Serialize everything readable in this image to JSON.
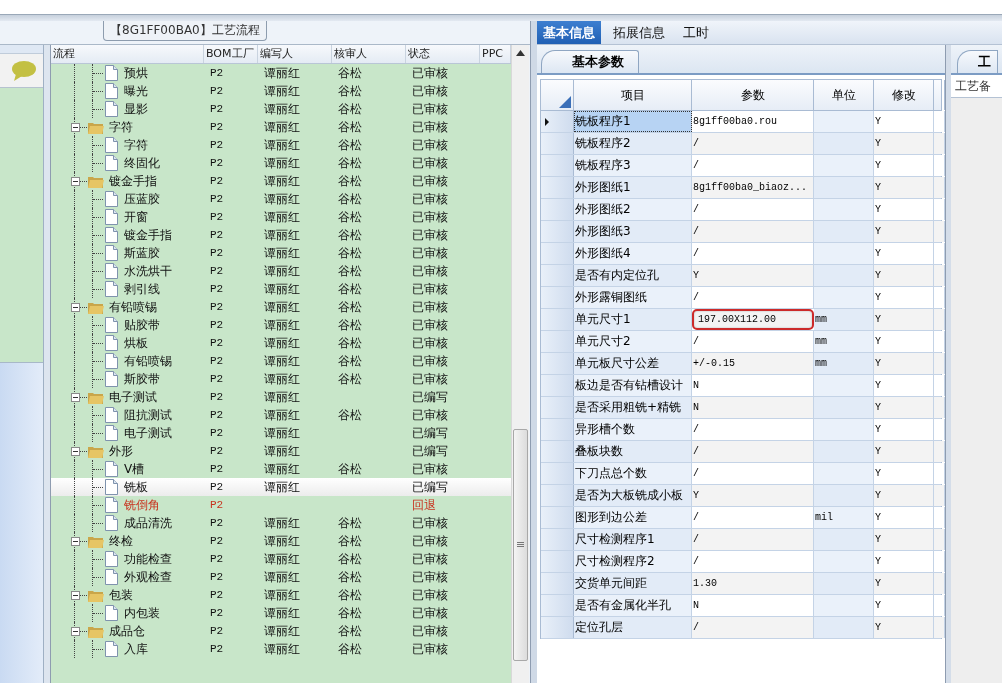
{
  "left_panel": {
    "title": "【8G1FF00BA0】工艺流程",
    "columns": [
      "流程",
      "BOM工厂",
      "编写人",
      "核审人",
      "状态",
      "PPC"
    ],
    "continued_children": [
      {
        "name": "预烘",
        "factory": "P2",
        "writer": "谭丽红",
        "reviewer": "谷松",
        "status": "已审核",
        "selected": false,
        "returned": false
      },
      {
        "name": "曝光",
        "factory": "P2",
        "writer": "谭丽红",
        "reviewer": "谷松",
        "status": "已审核",
        "selected": false,
        "returned": false
      },
      {
        "name": "显影",
        "factory": "P2",
        "writer": "谭丽红",
        "reviewer": "谷松",
        "status": "已审核",
        "selected": false,
        "returned": false
      }
    ],
    "groups": [
      {
        "name": "字符",
        "factory": "P2",
        "writer": "谭丽红",
        "reviewer": "谷松",
        "status": "已审核",
        "selected": false,
        "returned": false,
        "expanded": true,
        "children": [
          {
            "name": "字符",
            "factory": "P2",
            "writer": "谭丽红",
            "reviewer": "谷松",
            "status": "已审核",
            "selected": false,
            "returned": false
          },
          {
            "name": "终固化",
            "factory": "P2",
            "writer": "谭丽红",
            "reviewer": "谷松",
            "status": "已审核",
            "selected": false,
            "returned": false
          }
        ]
      },
      {
        "name": "镀金手指",
        "factory": "P2",
        "writer": "谭丽红",
        "reviewer": "谷松",
        "status": "已审核",
        "selected": false,
        "returned": false,
        "expanded": true,
        "children": [
          {
            "name": "压蓝胶",
            "factory": "P2",
            "writer": "谭丽红",
            "reviewer": "谷松",
            "status": "已审核",
            "selected": false,
            "returned": false
          },
          {
            "name": "开窗",
            "factory": "P2",
            "writer": "谭丽红",
            "reviewer": "谷松",
            "status": "已审核",
            "selected": false,
            "returned": false
          },
          {
            "name": "镀金手指",
            "factory": "P2",
            "writer": "谭丽红",
            "reviewer": "谷松",
            "status": "已审核",
            "selected": false,
            "returned": false
          },
          {
            "name": "斯蓝胶",
            "factory": "P2",
            "writer": "谭丽红",
            "reviewer": "谷松",
            "status": "已审核",
            "selected": false,
            "returned": false
          },
          {
            "name": "水洗烘干",
            "factory": "P2",
            "writer": "谭丽红",
            "reviewer": "谷松",
            "status": "已审核",
            "selected": false,
            "returned": false
          },
          {
            "name": "剥引线",
            "factory": "P2",
            "writer": "谭丽红",
            "reviewer": "谷松",
            "status": "已审核",
            "selected": false,
            "returned": false
          }
        ]
      },
      {
        "name": "有铅喷锡",
        "factory": "P2",
        "writer": "谭丽红",
        "reviewer": "谷松",
        "status": "已审核",
        "selected": false,
        "returned": false,
        "expanded": true,
        "children": [
          {
            "name": "贴胶带",
            "factory": "P2",
            "writer": "谭丽红",
            "reviewer": "谷松",
            "status": "已审核",
            "selected": false,
            "returned": false
          },
          {
            "name": "烘板",
            "factory": "P2",
            "writer": "谭丽红",
            "reviewer": "谷松",
            "status": "已审核",
            "selected": false,
            "returned": false
          },
          {
            "name": "有铅喷锡",
            "factory": "P2",
            "writer": "谭丽红",
            "reviewer": "谷松",
            "status": "已审核",
            "selected": false,
            "returned": false
          },
          {
            "name": "斯胶带",
            "factory": "P2",
            "writer": "谭丽红",
            "reviewer": "谷松",
            "status": "已审核",
            "selected": false,
            "returned": false
          }
        ]
      },
      {
        "name": "电子测试",
        "factory": "P2",
        "writer": "谭丽红",
        "status": "已编写",
        "selected": false,
        "returned": false,
        "expanded": true,
        "children": [
          {
            "name": "阻抗测试",
            "factory": "P2",
            "writer": "谭丽红",
            "reviewer": "谷松",
            "status": "已审核",
            "selected": false,
            "returned": false
          },
          {
            "name": "电子测试",
            "factory": "P2",
            "writer": "谭丽红",
            "status": "已编写",
            "selected": false,
            "returned": false
          }
        ]
      },
      {
        "name": "外形",
        "factory": "P2",
        "writer": "谭丽红",
        "status": "已编写",
        "selected": false,
        "returned": false,
        "expanded": true,
        "children": [
          {
            "name": "V槽",
            "factory": "P2",
            "writer": "谭丽红",
            "reviewer": "谷松",
            "status": "已审核",
            "selected": false,
            "returned": false
          },
          {
            "name": "铣板",
            "factory": "P2",
            "writer": "谭丽红",
            "status": "已编写",
            "selected": true,
            "returned": false
          },
          {
            "name": "铣倒角",
            "factory": "P2",
            "status": "回退",
            "selected": false,
            "returned": true
          },
          {
            "name": "成品清洗",
            "factory": "P2",
            "writer": "谭丽红",
            "reviewer": "谷松",
            "status": "已审核",
            "selected": false,
            "returned": false
          }
        ]
      },
      {
        "name": "终检",
        "factory": "P2",
        "writer": "谭丽红",
        "reviewer": "谷松",
        "status": "已审核",
        "selected": false,
        "returned": false,
        "expanded": true,
        "children": [
          {
            "name": "功能检查",
            "factory": "P2",
            "writer": "谭丽红",
            "reviewer": "谷松",
            "status": "已审核",
            "selected": false,
            "returned": false
          },
          {
            "name": "外观检查",
            "factory": "P2",
            "writer": "谭丽红",
            "reviewer": "谷松",
            "status": "已审核",
            "selected": false,
            "returned": false
          }
        ]
      },
      {
        "name": "包装",
        "factory": "P2",
        "writer": "谭丽红",
        "reviewer": "谷松",
        "status": "已审核",
        "selected": false,
        "returned": false,
        "expanded": true,
        "children": [
          {
            "name": "内包装",
            "factory": "P2",
            "writer": "谭丽红",
            "reviewer": "谷松",
            "status": "已审核",
            "selected": false,
            "returned": false
          }
        ]
      },
      {
        "name": "成品仓",
        "factory": "P2",
        "writer": "谭丽红",
        "reviewer": "谷松",
        "status": "已审核",
        "selected": false,
        "returned": false,
        "expanded": true,
        "children": [
          {
            "name": "入库",
            "factory": "P2",
            "writer": "谭丽红",
            "reviewer": "谷松",
            "status": "已审核",
            "selected": false,
            "returned": false
          }
        ]
      }
    ]
  },
  "right_panel": {
    "tabs": [
      {
        "label": "基本信息",
        "selected": true
      },
      {
        "label": "拓展信息",
        "selected": false
      },
      {
        "label": "工时",
        "selected": false
      }
    ],
    "subtab": "基本参数",
    "columns": [
      "项目",
      "参数",
      "单位",
      "修改"
    ],
    "rows": [
      {
        "item": "铣板程序1",
        "value": "8g1ff00ba0.rou",
        "modify": "Y",
        "selected": true,
        "highlighted": false
      },
      {
        "item": "铣板程序2",
        "value": "/",
        "modify": "Y",
        "selected": false,
        "highlighted": false
      },
      {
        "item": "铣板程序3",
        "value": "/",
        "modify": "Y",
        "selected": false,
        "highlighted": false
      },
      {
        "item": "外形图纸1",
        "value": "8g1ff00ba0_biaoz...",
        "modify": "Y",
        "selected": false,
        "highlighted": false
      },
      {
        "item": "外形图纸2",
        "value": "/",
        "modify": "Y",
        "selected": false,
        "highlighted": false
      },
      {
        "item": "外形图纸3",
        "value": "/",
        "modify": "Y",
        "selected": false,
        "highlighted": false
      },
      {
        "item": "外形图纸4",
        "value": "/",
        "modify": "Y",
        "selected": false,
        "highlighted": false
      },
      {
        "item": "是否有内定位孔",
        "value": "Y",
        "modify": "Y",
        "selected": false,
        "highlighted": false
      },
      {
        "item": "外形露铜图纸",
        "value": "/",
        "modify": "Y",
        "selected": false,
        "highlighted": false
      },
      {
        "item": "单元尺寸1",
        "value": "197.00X112.00",
        "unit": "mm",
        "modify": "Y",
        "selected": false,
        "highlighted": true
      },
      {
        "item": "单元尺寸2",
        "value": "/",
        "unit": "mm",
        "modify": "Y",
        "selected": false,
        "highlighted": false
      },
      {
        "item": "单元板尺寸公差",
        "value": "+/-0.15",
        "unit": "mm",
        "modify": "Y",
        "selected": false,
        "highlighted": false
      },
      {
        "item": "板边是否有钻槽设计",
        "value": "N",
        "modify": "Y",
        "selected": false,
        "highlighted": false
      },
      {
        "item": "是否采用粗铣+精铣",
        "value": "N",
        "modify": "Y",
        "selected": false,
        "highlighted": false
      },
      {
        "item": "异形槽个数",
        "value": "/",
        "modify": "Y",
        "selected": false,
        "highlighted": false
      },
      {
        "item": "叠板块数",
        "value": "/",
        "modify": "Y",
        "selected": false,
        "highlighted": false
      },
      {
        "item": "下刀点总个数",
        "value": "/",
        "modify": "Y",
        "selected": false,
        "highlighted": false
      },
      {
        "item": "是否为大板铣成小板",
        "value": "Y",
        "modify": "Y",
        "selected": false,
        "highlighted": false
      },
      {
        "item": "图形到边公差",
        "value": "/",
        "unit": "mil",
        "modify": "Y",
        "selected": false,
        "highlighted": false
      },
      {
        "item": "尺寸检测程序1",
        "value": "/",
        "modify": "Y",
        "selected": false,
        "highlighted": false
      },
      {
        "item": "尺寸检测程序2",
        "value": "/",
        "modify": "Y",
        "selected": false,
        "highlighted": false
      },
      {
        "item": "交货单元间距",
        "value": "1.30",
        "modify": "Y",
        "selected": false,
        "highlighted": false
      },
      {
        "item": "是否有金属化半孔",
        "value": "N",
        "modify": "Y",
        "selected": false,
        "highlighted": false
      },
      {
        "item": "定位孔层",
        "value": "/",
        "modify": "Y",
        "selected": false,
        "highlighted": false
      }
    ],
    "side_tab": "工",
    "side_label": "工艺备"
  }
}
